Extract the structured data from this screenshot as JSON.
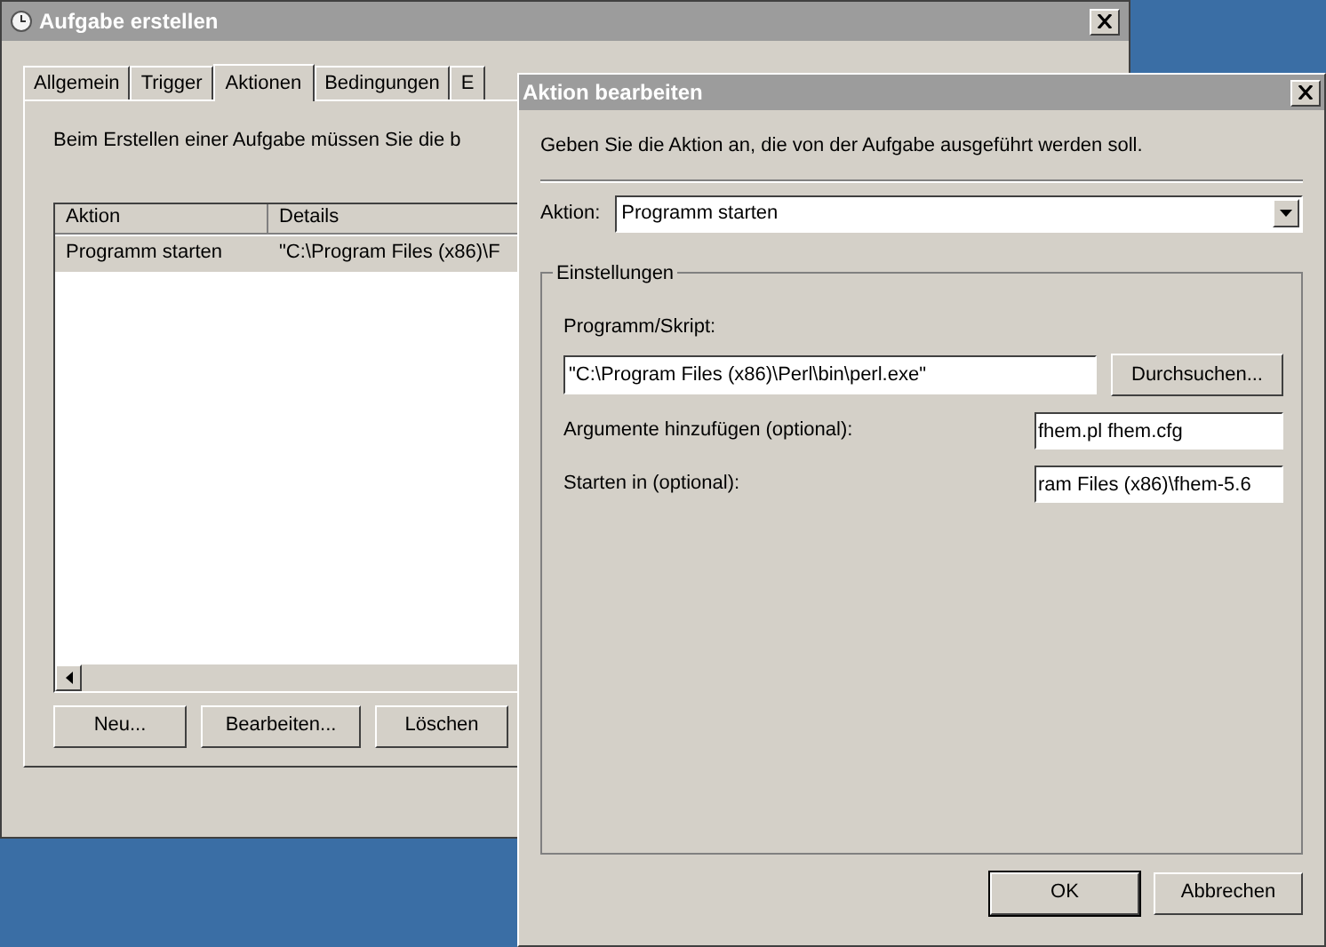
{
  "main_window": {
    "title": "Aufgabe erstellen",
    "tabs": [
      {
        "label": "Allgemein",
        "selected": false
      },
      {
        "label": "Trigger",
        "selected": false
      },
      {
        "label": "Aktionen",
        "selected": true
      },
      {
        "label": "Bedingungen",
        "selected": false
      },
      {
        "label": "E",
        "selected": false
      }
    ],
    "description": "Beim Erstellen einer Aufgabe müssen Sie die b",
    "table": {
      "columns": [
        "Aktion",
        "Details"
      ],
      "rows": [
        {
          "cells": [
            "Programm starten",
            "\"C:\\Program Files (x86)\\F"
          ],
          "selected": true
        }
      ]
    },
    "buttons": [
      "Neu...",
      "Bearbeiten...",
      "Löschen"
    ]
  },
  "dialog": {
    "title": "Aktion bearbeiten",
    "instruction": "Geben Sie die Aktion an, die von der Aufgabe ausgeführt werden soll.",
    "action_label": "Aktion:",
    "action_value": "Programm starten",
    "group_title": "Einstellungen",
    "fields": [
      {
        "kind": "wide",
        "label": "Programm/Skript:",
        "value": "\"C:\\Program Files (x86)\\Perl\\bin\\perl.exe\""
      },
      {
        "kind": "inline",
        "label": "Argumente hinzufügen (optional):",
        "value": "fhem.pl fhem.cfg"
      },
      {
        "kind": "inline",
        "label": "Starten in (optional):",
        "value": "ram Files (x86)\\fhem-5.6"
      }
    ],
    "browse_button": "Durchsuchen...",
    "buttons": [
      {
        "label": "OK",
        "default": true
      },
      {
        "label": "Abbrechen",
        "default": false
      }
    ]
  }
}
